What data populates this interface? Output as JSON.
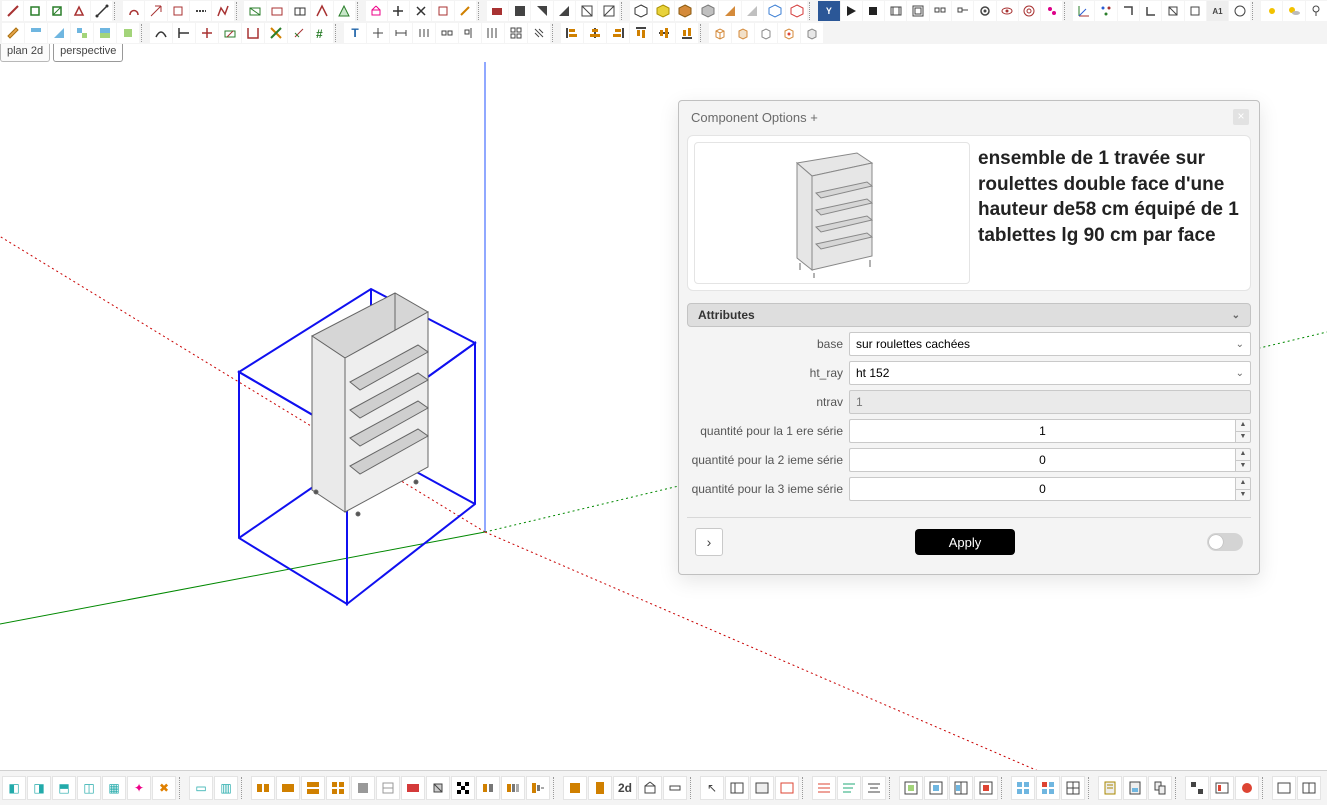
{
  "tabs": {
    "plan2d": "plan 2d",
    "perspective": "perspective"
  },
  "dialog": {
    "title": "Component Options +",
    "description": "ensemble de 1 travée sur roulettes double face d'une hauteur de58 cm équipé de 1 tablettes lg 90 cm par face",
    "section": "Attributes",
    "fields": {
      "base": {
        "label": "base",
        "value": "sur roulettes cachées"
      },
      "ht_ray": {
        "label": "ht_ray",
        "value": "ht 152"
      },
      "ntrav": {
        "label": "ntrav",
        "value": "1"
      },
      "q1": {
        "label": "quantité pour la 1 ere série",
        "value": "1"
      },
      "q2": {
        "label": "quantité pour la 2 ieme série",
        "value": "0"
      },
      "q3": {
        "label": "quantité pour la 3 ieme série",
        "value": "0"
      }
    },
    "apply": "Apply"
  },
  "bottombar": {
    "label2d": "2d"
  }
}
